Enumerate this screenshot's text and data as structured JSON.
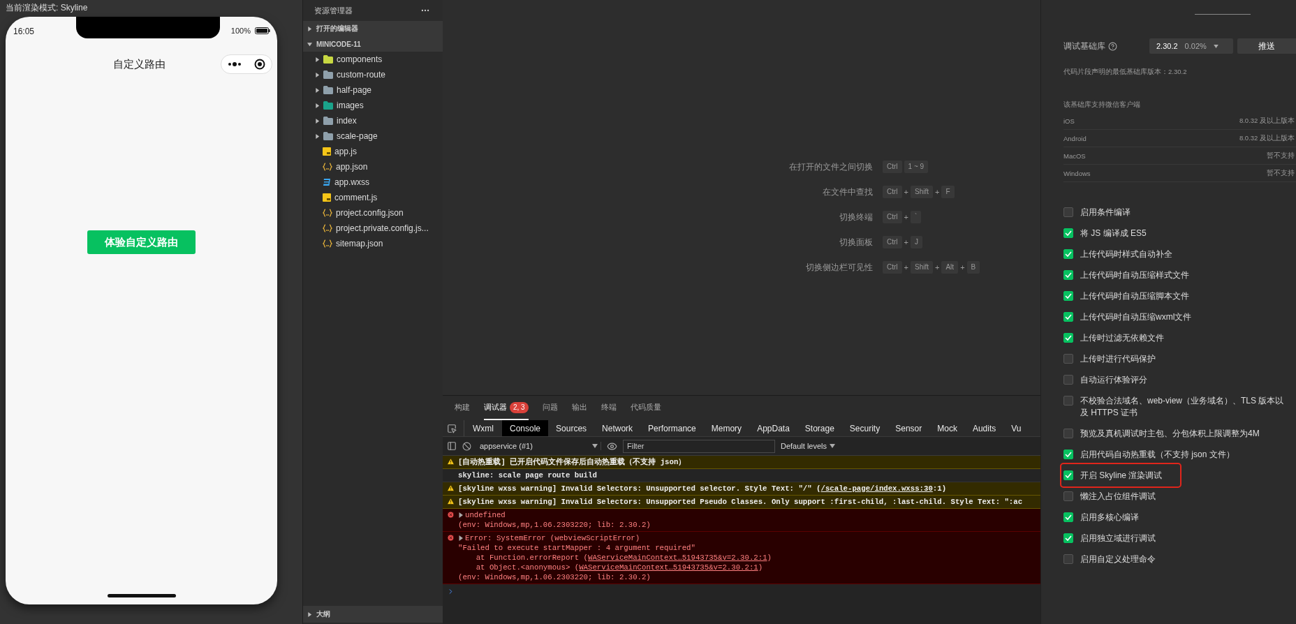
{
  "top_bar": {
    "render_mode": "当前渲染模式: Skyline"
  },
  "simulator": {
    "time": "16:05",
    "battery": "100%",
    "nav_title": "自定义路由",
    "button": "体验自定义路由"
  },
  "explorer": {
    "title": "资源管理器",
    "sections": [
      {
        "label": "打开的编辑器",
        "expanded": false
      },
      {
        "label": "MINICODE-11",
        "expanded": true,
        "children": [
          {
            "name": "components",
            "kind": "folder",
            "color": "#c8d842",
            "expanded": false
          },
          {
            "name": "custom-route",
            "kind": "folder",
            "color": "#8fa0ab",
            "expanded": false
          },
          {
            "name": "half-page",
            "kind": "folder",
            "color": "#8fa0ab",
            "expanded": false
          },
          {
            "name": "images",
            "kind": "folder",
            "color": "#1aa38a",
            "expanded": false
          },
          {
            "name": "index",
            "kind": "folder",
            "color": "#8fa0ab",
            "expanded": false
          },
          {
            "name": "scale-page",
            "kind": "folder",
            "color": "#8fa0ab",
            "expanded": false
          },
          {
            "name": "app.js",
            "kind": "js"
          },
          {
            "name": "app.json",
            "kind": "json"
          },
          {
            "name": "app.wxss",
            "kind": "wxss"
          },
          {
            "name": "comment.js",
            "kind": "js"
          },
          {
            "name": "project.config.json",
            "kind": "json"
          },
          {
            "name": "project.private.config.js...",
            "kind": "json"
          },
          {
            "name": "sitemap.json",
            "kind": "json"
          }
        ]
      }
    ],
    "outline": {
      "label": "大纲",
      "expanded": false
    }
  },
  "shortcuts": [
    {
      "label": "在打开的文件之间切换",
      "keys": [
        "Ctrl",
        "1 ~ 9"
      ]
    },
    {
      "label": "在文件中查找",
      "keys": [
        "Ctrl",
        "Shift",
        "F"
      ],
      "joiner": "+"
    },
    {
      "label": "切换终端",
      "keys": [
        "Ctrl",
        "`"
      ],
      "joiner": "+"
    },
    {
      "label": "切换面板",
      "keys": [
        "Ctrl",
        "J"
      ],
      "joiner": "+"
    },
    {
      "label": "切换侧边栏可见性",
      "keys": [
        "Ctrl",
        "Shift",
        "Alt",
        "B"
      ],
      "joiner": "+"
    }
  ],
  "bottom_panel": {
    "tabs": [
      {
        "label": "构建",
        "selected": false
      },
      {
        "label": "调试器",
        "selected": true,
        "badge": "2, 3"
      },
      {
        "label": "问题",
        "selected": false
      },
      {
        "label": "输出",
        "selected": false
      },
      {
        "label": "终端",
        "selected": false
      },
      {
        "label": "代码质量",
        "selected": false
      }
    ],
    "devtools_tabs": [
      {
        "label": "Wxml",
        "selected": false
      },
      {
        "label": "Console",
        "selected": true
      },
      {
        "label": "Sources",
        "selected": false
      },
      {
        "label": "Network",
        "selected": false
      },
      {
        "label": "Performance",
        "selected": false
      },
      {
        "label": "Memory",
        "selected": false
      },
      {
        "label": "AppData",
        "selected": false
      },
      {
        "label": "Storage",
        "selected": false
      },
      {
        "label": "Security",
        "selected": false
      },
      {
        "label": "Sensor",
        "selected": false
      },
      {
        "label": "Mock",
        "selected": false
      },
      {
        "label": "Audits",
        "selected": false
      },
      {
        "label": "Vu",
        "selected": false
      }
    ],
    "context": "appservice (#1)",
    "filter": {
      "placeholder": "Filter"
    },
    "levels": "Default levels",
    "messages": [
      {
        "kind": "warning",
        "lines": [
          [
            {
              "text": "[自动热重载] 已开启代码文件保存后自动热重载（不支持 json）"
            }
          ]
        ]
      },
      {
        "kind": "info",
        "lines": [
          [
            {
              "text": "skyline: scale page route build"
            }
          ]
        ]
      },
      {
        "kind": "warning",
        "lines": [
          [
            {
              "text": "[skyline wxss warning] Invalid Selectors: Unsupported selector. Style Text: \"/\" ("
            },
            {
              "text": "/scale-page/index.wxss:30",
              "link": true
            },
            {
              "text": ":1)"
            }
          ]
        ]
      },
      {
        "kind": "warning",
        "lines": [
          [
            {
              "text": "[skyline wxss warning] Invalid Selectors: Unsupported Pseudo Classes. Only support :first-child, :last-child. Style Text: \":ac"
            }
          ]
        ]
      },
      {
        "kind": "error",
        "expandable": true,
        "lines": [
          [
            {
              "text": "undefined"
            }
          ],
          [
            {
              "text": "(env: Windows,mp,1.06.2303220; lib: 2.30.2)"
            }
          ]
        ]
      },
      {
        "kind": "error",
        "expandable": true,
        "lines": [
          [
            {
              "text": "Error: SystemError (webviewScriptError)"
            }
          ],
          [
            {
              "text": "\"Failed to execute startMapper : 4 argument required\""
            }
          ],
          [
            {
              "text": "    at Function.errorReport ("
            },
            {
              "text": "WAServiceMainContext…51943735&v=2.30.2:1",
              "link": true
            },
            {
              "text": ")"
            }
          ],
          [
            {
              "text": "    at Object.<anonymous> ("
            },
            {
              "text": "WAServiceMainContext…51943735&v=2.30.2:1",
              "link": true
            },
            {
              "text": ")"
            }
          ],
          [
            {
              "text": "(env: Windows,mp,1.06.2303220; lib: 2.30.2)"
            }
          ]
        ]
      }
    ]
  },
  "settings": {
    "library": {
      "label": "调试基础库",
      "version": "2.30.2",
      "share": "0.02%",
      "push": "推送"
    },
    "note": "代码片段声明的最低基础库版本：2.30.2",
    "clients_title": "该基础库支持微信客户端",
    "clients": [
      {
        "name": "iOS",
        "value": "8.0.32 及以上版本"
      },
      {
        "name": "Android",
        "value": "8.0.32 及以上版本"
      },
      {
        "name": "MacOS",
        "value": "暂不支持"
      },
      {
        "name": "Windows",
        "value": "暂不支持"
      }
    ],
    "options": [
      {
        "label": "启用条件编译",
        "checked": false
      },
      {
        "label": "将 JS 编译成 ES5",
        "checked": true
      },
      {
        "label": "上传代码时样式自动补全",
        "checked": true
      },
      {
        "label": "上传代码时自动压缩样式文件",
        "checked": true
      },
      {
        "label": "上传代码时自动压缩脚本文件",
        "checked": true
      },
      {
        "label": "上传代码时自动压缩wxml文件",
        "checked": true
      },
      {
        "label": "上传时过滤无依赖文件",
        "checked": true
      },
      {
        "label": "上传时进行代码保护",
        "checked": false
      },
      {
        "label": "自动运行体验评分",
        "checked": false
      },
      {
        "label": "不校验合法域名、web-view（业务域名）、TLS 版本以及 HTTPS 证书",
        "checked": false
      },
      {
        "label": "预览及真机调试时主包、分包体积上限调整为4M",
        "checked": false
      },
      {
        "label": "启用代码自动热重载（不支持 json 文件）",
        "checked": true
      },
      {
        "label": "开启 Skyline 渲染调试",
        "checked": true,
        "highlighted": true
      },
      {
        "label": "懒注入占位组件调试",
        "checked": false
      },
      {
        "label": "启用多核心编译",
        "checked": true
      },
      {
        "label": "启用独立域进行调试",
        "checked": true
      },
      {
        "label": "启用自定义处理命令",
        "checked": false
      }
    ]
  }
}
